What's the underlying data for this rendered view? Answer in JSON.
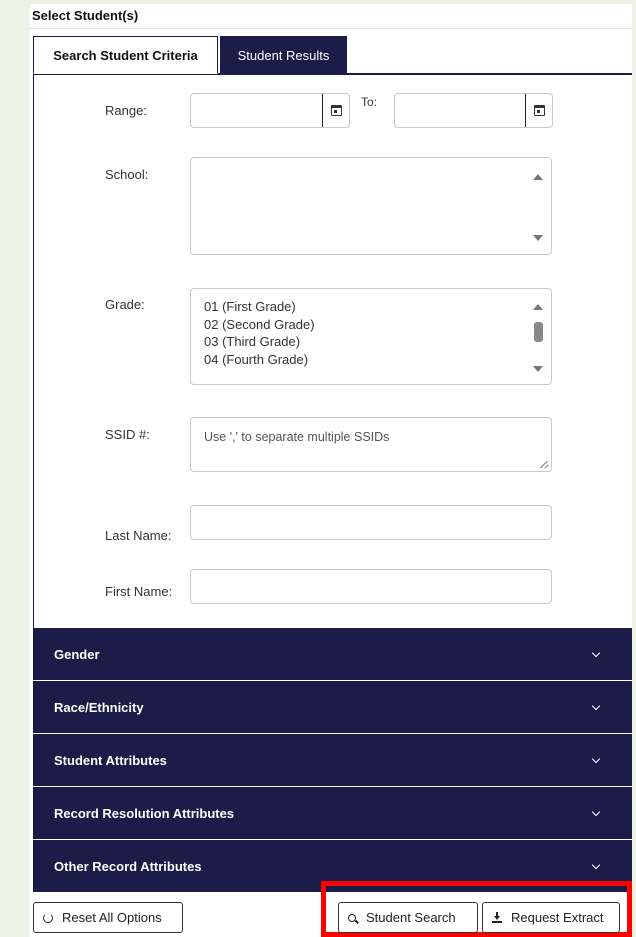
{
  "header": {
    "title": "Select Student(s)"
  },
  "tabs": [
    {
      "label": "Search Student Criteria",
      "active": true
    },
    {
      "label": "Student Results",
      "active": false
    }
  ],
  "form": {
    "range_label": "Range:",
    "to_label": "To:",
    "range_from_value": "",
    "range_to_value": "",
    "school_label": "School:",
    "grade_label": "Grade:",
    "grade_options": [
      "01 (First Grade)",
      "02 (Second Grade)",
      "03 (Third Grade)",
      "04 (Fourth Grade)"
    ],
    "ssid_label": "SSID #:",
    "ssid_placeholder": "Use ',' to separate multiple SSIDs",
    "last_name_label": "Last Name:",
    "last_name_value": "",
    "first_name_label": "First Name:",
    "first_name_value": ""
  },
  "accordions": [
    {
      "label": "Gender"
    },
    {
      "label": "Race/Ethnicity"
    },
    {
      "label": "Student Attributes"
    },
    {
      "label": "Record Resolution Attributes"
    },
    {
      "label": "Other Record Attributes"
    }
  ],
  "buttons": {
    "reset": "Reset All Options",
    "search": "Student Search",
    "extract": "Request Extract"
  },
  "colors": {
    "navy": "#1b1c48",
    "highlight": "#ff0000",
    "background": "#eef2e4"
  },
  "icons": {
    "calendar": "calendar-icon",
    "reset": "reset-icon",
    "search": "search-icon",
    "extract": "download-icon",
    "accordion": "chevron-down-icon"
  }
}
